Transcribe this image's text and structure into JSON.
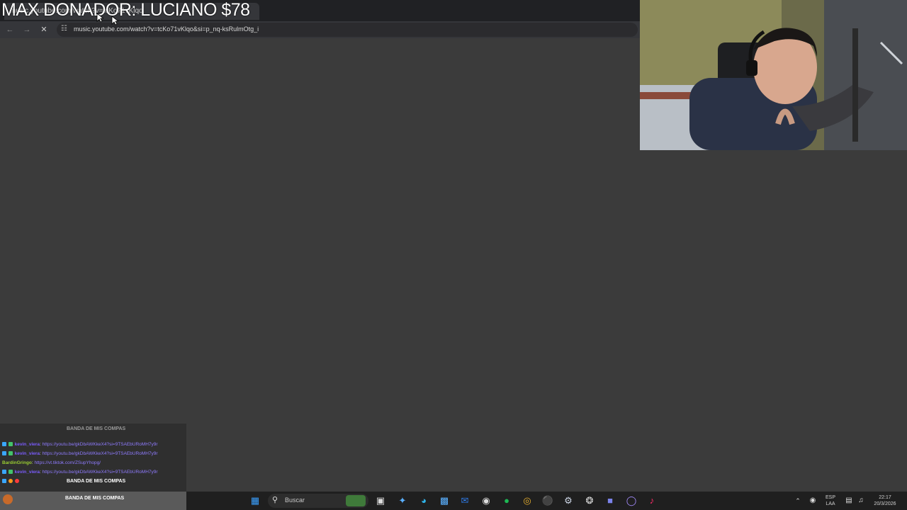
{
  "browser": {
    "tab_title": "music.youtube.com/watch?v=tcKo71vKlqo",
    "url": "music.youtube.com/watch?v=tcKo71vKlqo&si=p_nq-ksRulmOtg_i",
    "reload_label": "✕"
  },
  "overlay": {
    "donor_text": "MAX DONADOR: LUCIANO $78"
  },
  "chat": {
    "header": "BANDA DE MIS COMPAS",
    "messages": [
      {
        "user": "kevin_viera",
        "user_color": "#7b5cff",
        "text": "https://youtu.be/gkDbAWKkeX4?si=9TSAEbURoMH7y9r"
      },
      {
        "user": "kevin_viera",
        "user_color": "#7b5cff",
        "text": "https://youtu.be/gkDbAWKkeX4?si=9TSAEbURoMH7y9r"
      },
      {
        "user": "BardinGringo",
        "user_color": "#9acd32",
        "text": "https://vt.tiktok.com/ZSupYhopg/"
      },
      {
        "user": "kevin_viera",
        "user_color": "#7b5cff",
        "text": "https://youtu.be/gkDbAWKkeX4?si=9TSAEbURoMH7y9r"
      }
    ],
    "footer": "BANDA DE MIS COMPAS",
    "footer2": "BANDA DE MIS COMPAS"
  },
  "taskbar": {
    "search_placeholder": "Buscar",
    "lang_top": "ESP",
    "lang_bottom": "LAA",
    "time": "22:17",
    "date": "20/3/2026"
  },
  "colors": {
    "page_bg": "#3b3b3b",
    "tabbar_bg": "#202124",
    "taskbar_bg": "#1f1f1f"
  }
}
